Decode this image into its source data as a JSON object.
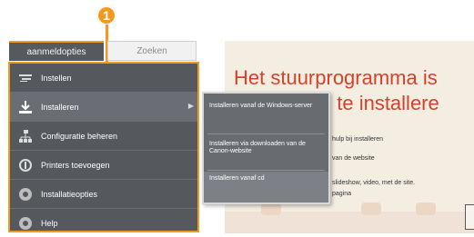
{
  "callout": {
    "number": "1",
    "color": "#f39a1e"
  },
  "tabs": [
    {
      "label": "aanmeldopties",
      "active": true
    },
    {
      "label": "Zoeken",
      "active": false
    }
  ],
  "menu": {
    "items": [
      {
        "label": "Instellen",
        "icon": "settings-icon",
        "has_submenu": false
      },
      {
        "label": "Installeren",
        "icon": "install-icon",
        "has_submenu": true
      },
      {
        "label": "Configuratie beheren",
        "icon": "network-icon",
        "has_submenu": false
      },
      {
        "label": "Printers toevoegen",
        "icon": "printer-icon",
        "has_submenu": false
      },
      {
        "label": "Installatieopties",
        "icon": "options-icon",
        "has_submenu": false
      },
      {
        "label": "Help",
        "icon": "help-icon",
        "has_submenu": false
      }
    ]
  },
  "submenu": {
    "items": [
      {
        "label": "Installeren vanaf de Windows-server"
      },
      {
        "label": "Installeren via downloaden van de Canon-website"
      },
      {
        "label": "Installeren vanaf cd",
        "selected": true
      }
    ]
  },
  "background": {
    "title_line1": "Het stuurprogramma is",
    "title_line2": "ig te installere",
    "body_line1": "hulp bij installeren",
    "body_line2": "van de website",
    "body_line3": "slideshow, video, met de site.",
    "body_line4": "pagina"
  }
}
